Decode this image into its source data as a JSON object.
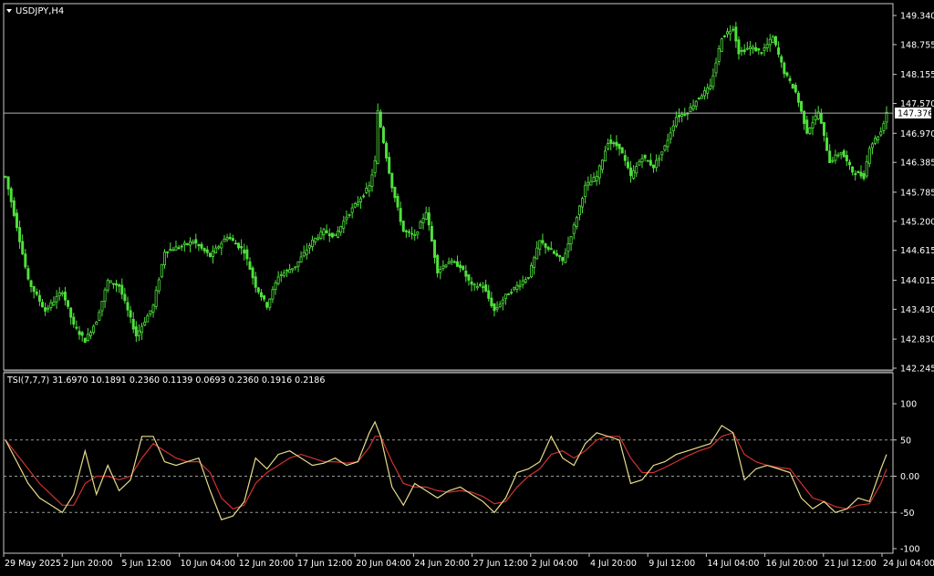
{
  "main_panel": {
    "title": "USDJPY,H4",
    "dropdown_icon": "triangle-down-icon",
    "current_price": "147.376",
    "price_ticks": [
      "149.340",
      "148.755",
      "148.155",
      "147.570",
      "146.970",
      "146.385",
      "145.785",
      "145.200",
      "144.615",
      "144.015",
      "143.430",
      "142.830",
      "142.245"
    ]
  },
  "indicator_panel": {
    "label": "TSI(7,7,7) 31.6970 10.1891 0.2360 0.1139 0.0693 0.2360 0.1916 0.2186",
    "ticks": [
      "100",
      "50",
      "0.00",
      "-50",
      "-100"
    ]
  },
  "time_axis": {
    "labels": [
      "29 May 2025",
      "2 Jun 20:00",
      "5 Jun 12:00",
      "10 Jun 04:00",
      "12 Jun 20:00",
      "17 Jun 12:00",
      "20 Jun 04:00",
      "24 Jun 20:00",
      "27 Jun 12:00",
      "2 Jul 04:00",
      "4 Jul 20:00",
      "9 Jul 12:00",
      "14 Jul 04:00",
      "16 Jul 20:00",
      "21 Jul 12:00",
      "24 Jul 04:00"
    ]
  },
  "colors": {
    "background": "#000000",
    "frame": "#c8c8c8",
    "candle": "#4fe03c",
    "tsi_line": "#e6dc8a",
    "signal_line": "#d23232",
    "level_lines": "#9a9a9a",
    "text": "#ffffff"
  },
  "chart_data": [
    {
      "type": "candlestick",
      "symbol": "USDJPY",
      "timeframe": "H4",
      "ylim": [
        142.245,
        149.34
      ],
      "last_price": 147.376,
      "close_path": [
        [
          0,
          146.1
        ],
        [
          4,
          145.1
        ],
        [
          8,
          144.0
        ],
        [
          14,
          143.4
        ],
        [
          20,
          143.8
        ],
        [
          24,
          143.1
        ],
        [
          28,
          142.8
        ],
        [
          32,
          143.2
        ],
        [
          36,
          144.0
        ],
        [
          40,
          143.9
        ],
        [
          46,
          142.9
        ],
        [
          52,
          143.5
        ],
        [
          56,
          144.6
        ],
        [
          62,
          144.7
        ],
        [
          66,
          144.8
        ],
        [
          72,
          144.5
        ],
        [
          78,
          144.9
        ],
        [
          84,
          144.6
        ],
        [
          88,
          143.9
        ],
        [
          92,
          143.5
        ],
        [
          96,
          144.1
        ],
        [
          102,
          144.3
        ],
        [
          108,
          144.8
        ],
        [
          112,
          145.0
        ],
        [
          116,
          144.9
        ],
        [
          120,
          145.3
        ],
        [
          124,
          145.6
        ],
        [
          128,
          145.9
        ],
        [
          130,
          146.4
        ],
        [
          131,
          147.4
        ],
        [
          132,
          147.1
        ],
        [
          136,
          145.9
        ],
        [
          140,
          145.0
        ],
        [
          144,
          144.9
        ],
        [
          148,
          145.4
        ],
        [
          152,
          144.2
        ],
        [
          156,
          144.4
        ],
        [
          160,
          144.3
        ],
        [
          164,
          143.9
        ],
        [
          168,
          143.9
        ],
        [
          172,
          143.4
        ],
        [
          176,
          143.7
        ],
        [
          180,
          143.9
        ],
        [
          184,
          144.1
        ],
        [
          188,
          144.8
        ],
        [
          192,
          144.6
        ],
        [
          196,
          144.4
        ],
        [
          200,
          145.1
        ],
        [
          204,
          145.9
        ],
        [
          208,
          146.1
        ],
        [
          212,
          146.8
        ],
        [
          216,
          146.7
        ],
        [
          220,
          146.1
        ],
        [
          224,
          146.5
        ],
        [
          228,
          146.3
        ],
        [
          232,
          146.7
        ],
        [
          236,
          147.3
        ],
        [
          240,
          147.4
        ],
        [
          244,
          147.7
        ],
        [
          248,
          147.9
        ],
        [
          252,
          148.9
        ],
        [
          256,
          149.1
        ],
        [
          258,
          148.6
        ],
        [
          262,
          148.7
        ],
        [
          266,
          148.6
        ],
        [
          270,
          148.9
        ],
        [
          274,
          148.2
        ],
        [
          278,
          147.8
        ],
        [
          282,
          147.0
        ],
        [
          286,
          147.4
        ],
        [
          290,
          146.4
        ],
        [
          294,
          146.6
        ],
        [
          298,
          146.2
        ],
        [
          302,
          146.1
        ],
        [
          304,
          146.7
        ],
        [
          308,
          147.0
        ],
        [
          310,
          147.4
        ]
      ]
    },
    {
      "type": "line",
      "name": "TSI(7,7,7)",
      "ylim": [
        -100,
        100
      ],
      "levels": [
        50,
        0,
        -50
      ],
      "series": [
        {
          "name": "TSI",
          "points": [
            [
              0,
              50
            ],
            [
              4,
              20
            ],
            [
              8,
              -10
            ],
            [
              12,
              -30
            ],
            [
              16,
              -40
            ],
            [
              20,
              -50
            ],
            [
              24,
              -25
            ],
            [
              28,
              35
            ],
            [
              32,
              -25
            ],
            [
              36,
              15
            ],
            [
              40,
              -20
            ],
            [
              44,
              -5
            ],
            [
              48,
              55
            ],
            [
              52,
              55
            ],
            [
              56,
              20
            ],
            [
              60,
              15
            ],
            [
              64,
              20
            ],
            [
              68,
              25
            ],
            [
              72,
              -20
            ],
            [
              76,
              -60
            ],
            [
              80,
              -55
            ],
            [
              84,
              -35
            ],
            [
              88,
              25
            ],
            [
              92,
              10
            ],
            [
              96,
              30
            ],
            [
              100,
              35
            ],
            [
              104,
              25
            ],
            [
              108,
              15
            ],
            [
              112,
              18
            ],
            [
              116,
              25
            ],
            [
              120,
              15
            ],
            [
              124,
              20
            ],
            [
              128,
              60
            ],
            [
              130,
              75
            ],
            [
              132,
              55
            ],
            [
              136,
              -15
            ],
            [
              140,
              -40
            ],
            [
              144,
              -10
            ],
            [
              148,
              -20
            ],
            [
              152,
              -30
            ],
            [
              156,
              -20
            ],
            [
              160,
              -15
            ],
            [
              164,
              -25
            ],
            [
              168,
              -35
            ],
            [
              172,
              -50
            ],
            [
              176,
              -30
            ],
            [
              180,
              5
            ],
            [
              184,
              10
            ],
            [
              188,
              20
            ],
            [
              192,
              55
            ],
            [
              196,
              25
            ],
            [
              200,
              15
            ],
            [
              204,
              45
            ],
            [
              208,
              60
            ],
            [
              212,
              55
            ],
            [
              216,
              50
            ],
            [
              220,
              -10
            ],
            [
              224,
              -5
            ],
            [
              228,
              15
            ],
            [
              232,
              20
            ],
            [
              236,
              30
            ],
            [
              240,
              35
            ],
            [
              244,
              40
            ],
            [
              248,
              45
            ],
            [
              252,
              70
            ],
            [
              256,
              60
            ],
            [
              260,
              -5
            ],
            [
              264,
              10
            ],
            [
              268,
              15
            ],
            [
              272,
              10
            ],
            [
              276,
              5
            ],
            [
              280,
              -30
            ],
            [
              284,
              -45
            ],
            [
              288,
              -35
            ],
            [
              292,
              -50
            ],
            [
              296,
              -45
            ],
            [
              300,
              -30
            ],
            [
              304,
              -35
            ],
            [
              308,
              10
            ],
            [
              310,
              30
            ]
          ]
        },
        {
          "name": "Signal",
          "points": [
            [
              0,
              50
            ],
            [
              4,
              30
            ],
            [
              8,
              10
            ],
            [
              12,
              -10
            ],
            [
              16,
              -25
            ],
            [
              20,
              -40
            ],
            [
              24,
              -40
            ],
            [
              28,
              -10
            ],
            [
              32,
              0
            ],
            [
              36,
              0
            ],
            [
              40,
              -5
            ],
            [
              44,
              0
            ],
            [
              48,
              25
            ],
            [
              52,
              45
            ],
            [
              56,
              35
            ],
            [
              60,
              25
            ],
            [
              64,
              20
            ],
            [
              68,
              20
            ],
            [
              72,
              5
            ],
            [
              76,
              -30
            ],
            [
              80,
              -45
            ],
            [
              84,
              -40
            ],
            [
              88,
              -10
            ],
            [
              92,
              5
            ],
            [
              96,
              15
            ],
            [
              100,
              25
            ],
            [
              104,
              30
            ],
            [
              108,
              25
            ],
            [
              112,
              20
            ],
            [
              116,
              20
            ],
            [
              120,
              18
            ],
            [
              124,
              20
            ],
            [
              128,
              40
            ],
            [
              130,
              55
            ],
            [
              132,
              55
            ],
            [
              136,
              20
            ],
            [
              140,
              -10
            ],
            [
              144,
              -15
            ],
            [
              148,
              -15
            ],
            [
              152,
              -20
            ],
            [
              156,
              -22
            ],
            [
              160,
              -20
            ],
            [
              164,
              -22
            ],
            [
              168,
              -28
            ],
            [
              172,
              -38
            ],
            [
              176,
              -35
            ],
            [
              180,
              -15
            ],
            [
              184,
              0
            ],
            [
              188,
              10
            ],
            [
              192,
              30
            ],
            [
              196,
              35
            ],
            [
              200,
              25
            ],
            [
              204,
              35
            ],
            [
              208,
              50
            ],
            [
              212,
              55
            ],
            [
              216,
              55
            ],
            [
              220,
              25
            ],
            [
              224,
              5
            ],
            [
              228,
              5
            ],
            [
              232,
              12
            ],
            [
              236,
              20
            ],
            [
              240,
              28
            ],
            [
              244,
              35
            ],
            [
              248,
              40
            ],
            [
              252,
              55
            ],
            [
              256,
              60
            ],
            [
              260,
              30
            ],
            [
              264,
              20
            ],
            [
              268,
              15
            ],
            [
              272,
              12
            ],
            [
              276,
              10
            ],
            [
              280,
              -10
            ],
            [
              284,
              -30
            ],
            [
              288,
              -35
            ],
            [
              292,
              -42
            ],
            [
              296,
              -45
            ],
            [
              300,
              -40
            ],
            [
              304,
              -38
            ],
            [
              308,
              -10
            ],
            [
              310,
              10
            ]
          ]
        }
      ]
    }
  ]
}
